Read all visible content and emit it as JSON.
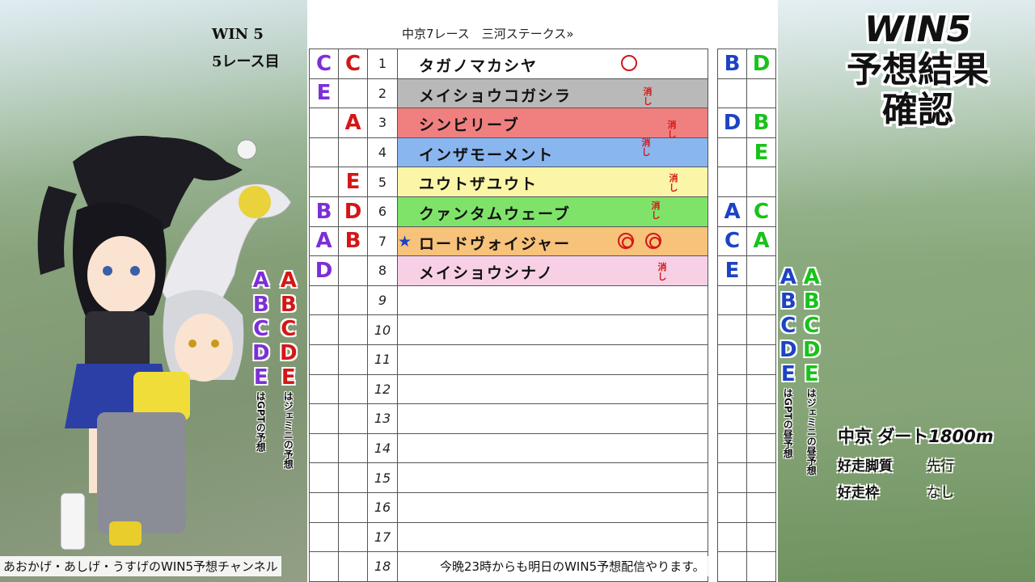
{
  "win5_label": "WIN 5",
  "race_number_label": "5レース目",
  "race_header": "中京7レース　三河ステークス»",
  "title_line1": "WIN5",
  "title_line2": "予想結果",
  "title_line3": "確認",
  "keshi_text": "消し",
  "circle_mark": "○",
  "double_circle_mark": "◎",
  "star_mark": "★",
  "colors": {
    "purple": "#7d2fd6",
    "red": "#d31717",
    "blue": "#1d43c4",
    "green": "#18c21a"
  },
  "rows": [
    {
      "num": "1",
      "horse": "タガノマカシヤ",
      "color": "#ffffff",
      "gpt_pick": "C",
      "gemini_pick": "C",
      "gpt_noon": "B",
      "gemini_noon": "D"
    },
    {
      "num": "2",
      "horse": "メイショウコガシラ",
      "color": "#b9b9b9",
      "gpt_pick": "E",
      "gemini_pick": "",
      "gpt_noon": "",
      "gemini_noon": ""
    },
    {
      "num": "3",
      "horse": "シンビリーブ",
      "color": "#f08080",
      "gpt_pick": "",
      "gemini_pick": "A",
      "gpt_noon": "D",
      "gemini_noon": "B"
    },
    {
      "num": "4",
      "horse": "インザモーメント",
      "color": "#8ab6f0",
      "gpt_pick": "",
      "gemini_pick": "",
      "gpt_noon": "",
      "gemini_noon": "E"
    },
    {
      "num": "5",
      "horse": "ユウトザユウト",
      "color": "#fbf5a8",
      "gpt_pick": "",
      "gemini_pick": "E",
      "gpt_noon": "",
      "gemini_noon": ""
    },
    {
      "num": "6",
      "horse": "クァンタムウェーブ",
      "color": "#7fe36a",
      "gpt_pick": "B",
      "gemini_pick": "D",
      "gpt_noon": "A",
      "gemini_noon": "C"
    },
    {
      "num": "7",
      "horse": "ロードヴォイジャー",
      "color": "#f7c27a",
      "gpt_pick": "A",
      "gemini_pick": "B",
      "gpt_noon": "C",
      "gemini_noon": "A"
    },
    {
      "num": "8",
      "horse": "メイショウシナノ",
      "color": "#f7d0e6",
      "gpt_pick": "D",
      "gemini_pick": "",
      "gpt_noon": "E",
      "gemini_noon": ""
    },
    {
      "num": "9",
      "horse": "",
      "color": "#ffffff",
      "gpt_pick": "",
      "gemini_pick": "",
      "gpt_noon": "",
      "gemini_noon": ""
    },
    {
      "num": "10",
      "horse": "",
      "color": "#ffffff",
      "gpt_pick": "",
      "gemini_pick": "",
      "gpt_noon": "",
      "gemini_noon": ""
    },
    {
      "num": "11",
      "horse": "",
      "color": "#ffffff",
      "gpt_pick": "",
      "gemini_pick": "",
      "gpt_noon": "",
      "gemini_noon": ""
    },
    {
      "num": "12",
      "horse": "",
      "color": "#ffffff",
      "gpt_pick": "",
      "gemini_pick": "",
      "gpt_noon": "",
      "gemini_noon": ""
    },
    {
      "num": "13",
      "horse": "",
      "color": "#ffffff",
      "gpt_pick": "",
      "gemini_pick": "",
      "gpt_noon": "",
      "gemini_noon": ""
    },
    {
      "num": "14",
      "horse": "",
      "color": "#ffffff",
      "gpt_pick": "",
      "gemini_pick": "",
      "gpt_noon": "",
      "gemini_noon": ""
    },
    {
      "num": "15",
      "horse": "",
      "color": "#ffffff",
      "gpt_pick": "",
      "gemini_pick": "",
      "gpt_noon": "",
      "gemini_noon": ""
    },
    {
      "num": "16",
      "horse": "",
      "color": "#ffffff",
      "gpt_pick": "",
      "gemini_pick": "",
      "gpt_noon": "",
      "gemini_noon": ""
    },
    {
      "num": "17",
      "horse": "",
      "color": "#ffffff",
      "gpt_pick": "",
      "gemini_pick": "",
      "gpt_noon": "",
      "gemini_noon": ""
    },
    {
      "num": "18",
      "horse": "",
      "color": "#ffffff",
      "gpt_pick": "",
      "gemini_pick": "",
      "gpt_noon": "",
      "gemini_noon": ""
    }
  ],
  "legend_letters": [
    "A",
    "B",
    "C",
    "D",
    "E"
  ],
  "legend_gpt": "はGPTの予想",
  "legend_gemini": "はジェミニの予想",
  "legend_gpt_noon": "はGPTの昼予想",
  "legend_gemini_noon": "はジェミニの昼予想",
  "course": "中京 ",
  "course_track": "ダート",
  "course_distance": "1800m",
  "info_rows": [
    {
      "key": "好走脚質",
      "value": "先行"
    },
    {
      "key": "好走枠",
      "value": "なし"
    }
  ],
  "footer_left": "あおかげ・あしげ・うすげのWIN5予想チャンネル",
  "footer_right": "今晩23時からも明日のWIN5予想配信やります。"
}
